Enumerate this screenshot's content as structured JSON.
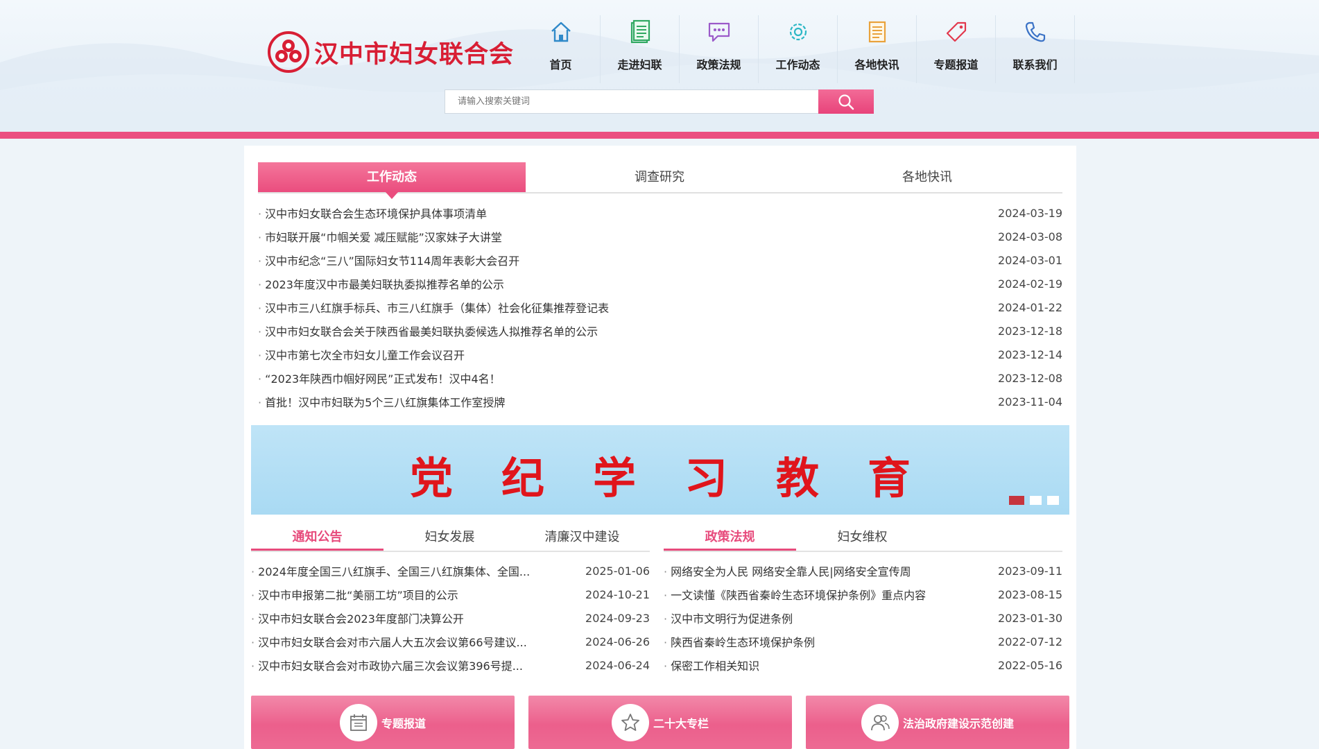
{
  "site": {
    "logo_text": "汉中市妇女联合会"
  },
  "nav": [
    {
      "label": "首页",
      "icon": "home-icon"
    },
    {
      "label": "走进妇联",
      "icon": "document-icon"
    },
    {
      "label": "政策法规",
      "icon": "chat-icon"
    },
    {
      "label": "工作动态",
      "icon": "gear-icon"
    },
    {
      "label": "各地快讯",
      "icon": "list-icon"
    },
    {
      "label": "专题报道",
      "icon": "tag-icon"
    },
    {
      "label": "联系我们",
      "icon": "phone-icon"
    }
  ],
  "search": {
    "placeholder": "请输入搜索关键词"
  },
  "tabs_top": [
    {
      "label": "工作动态",
      "active": true
    },
    {
      "label": "调查研究",
      "active": false
    },
    {
      "label": "各地快讯",
      "active": false
    }
  ],
  "news_top": [
    {
      "title": "汉中市妇女联合会生态环境保护具体事项清单",
      "date": "2024-03-19"
    },
    {
      "title": "市妇联开展“巾帼关爱 减压赋能”汉家妹子大讲堂",
      "date": "2024-03-08"
    },
    {
      "title": "汉中市纪念“三八”国际妇女节114周年表彰大会召开",
      "date": "2024-03-01"
    },
    {
      "title": "2023年度汉中市最美妇联执委拟推荐名单的公示",
      "date": "2024-02-19"
    },
    {
      "title": "汉中市三八红旗手标兵、市三八红旗手（集体）社会化征集推荐登记表",
      "date": "2024-01-22"
    },
    {
      "title": "汉中市妇女联合会关于陕西省最美妇联执委候选人拟推荐名单的公示",
      "date": "2023-12-18"
    },
    {
      "title": "汉中市第七次全市妇女儿童工作会议召开",
      "date": "2023-12-14"
    },
    {
      "title": "“2023年陕西巾帼好网民”正式发布！汉中4名！",
      "date": "2023-12-08"
    },
    {
      "title": "首批！汉中市妇联为5个三八红旗集体工作室授牌",
      "date": "2023-11-04"
    }
  ],
  "banner": {
    "text": "党纪学习教育",
    "slides_count": 3,
    "active_slide": 1
  },
  "tabs_left": [
    {
      "label": "通知公告",
      "active": true
    },
    {
      "label": "妇女发展",
      "active": false
    },
    {
      "label": "清廉汉中建设",
      "active": false
    }
  ],
  "list_left": [
    {
      "title": "2024年度全国三八红旗手、全国三八红旗集体、全国...",
      "date": "2025-01-06"
    },
    {
      "title": "汉中市申报第二批“美丽工坊”项目的公示",
      "date": "2024-10-21"
    },
    {
      "title": "汉中市妇女联合会2023年度部门决算公开",
      "date": "2024-09-23"
    },
    {
      "title": "汉中市妇女联合会对市六届人大五次会议第66号建议...",
      "date": "2024-06-26"
    },
    {
      "title": "汉中市妇女联合会对市政协六届三次会议第396号提...",
      "date": "2024-06-24"
    }
  ],
  "tabs_right": [
    {
      "label": "政策法规",
      "active": true
    },
    {
      "label": "妇女维权",
      "active": false
    }
  ],
  "list_right": [
    {
      "title": "网络安全为人民 网络安全靠人民|网络安全宣传周",
      "date": "2023-09-11"
    },
    {
      "title": "一文读懂《陕西省秦岭生态环境保护条例》重点内容",
      "date": "2023-08-15"
    },
    {
      "title": "汉中市文明行为促进条例",
      "date": "2023-01-30"
    },
    {
      "title": "陕西省秦岭生态环境保护条例",
      "date": "2022-07-12"
    },
    {
      "title": "保密工作相关知识",
      "date": "2022-05-16"
    }
  ],
  "cards": [
    {
      "label": "专题报道",
      "icon": "calendar-icon"
    },
    {
      "label": "二十大专栏",
      "icon": "star-icon"
    },
    {
      "label": "法治政府建设示范创建",
      "icon": "people-icon"
    }
  ],
  "colors": {
    "brand_red": "#d81e34",
    "accent_pink": "#eb4f81",
    "banner_bg": "#bfe4f7",
    "banner_text": "#e0151c"
  }
}
